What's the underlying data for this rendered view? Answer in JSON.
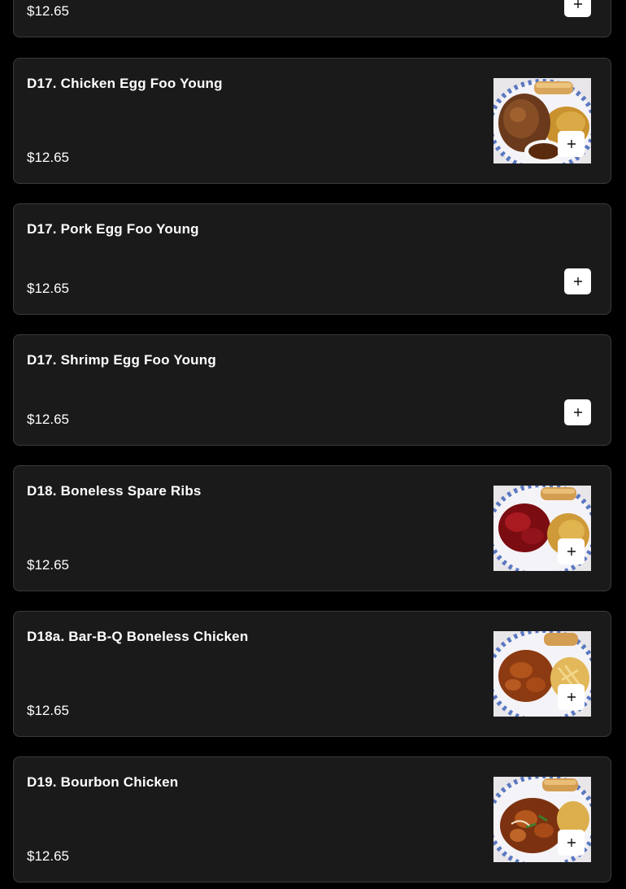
{
  "items": [
    {
      "name": "",
      "price": "$12.65",
      "add_icon": "plus-icon"
    },
    {
      "name": "D17. Chicken Egg Foo Young",
      "price": "$12.65",
      "photo": "egg-foo-young-plate",
      "add_icon": "plus-icon"
    },
    {
      "name": "D17. Pork Egg Foo Young",
      "price": "$12.65",
      "add_icon": "plus-icon"
    },
    {
      "name": "D17. Shrimp Egg Foo Young",
      "price": "$12.65",
      "add_icon": "plus-icon"
    },
    {
      "name": "D18. Boneless Spare Ribs",
      "price": "$12.65",
      "photo": "boneless-spare-ribs-plate",
      "add_icon": "plus-icon"
    },
    {
      "name": "D18a. Bar-B-Q Boneless Chicken",
      "price": "$12.65",
      "photo": "bbq-chicken-plate",
      "add_icon": "plus-icon"
    },
    {
      "name": "D19. Bourbon Chicken",
      "price": "$12.65",
      "photo": "bourbon-chicken-plate",
      "add_icon": "plus-icon"
    }
  ],
  "colors": {
    "page_background": "#000000",
    "card_background": "#1a1a1a",
    "card_border": "#3a3a3a",
    "add_button": "#ffffff"
  }
}
